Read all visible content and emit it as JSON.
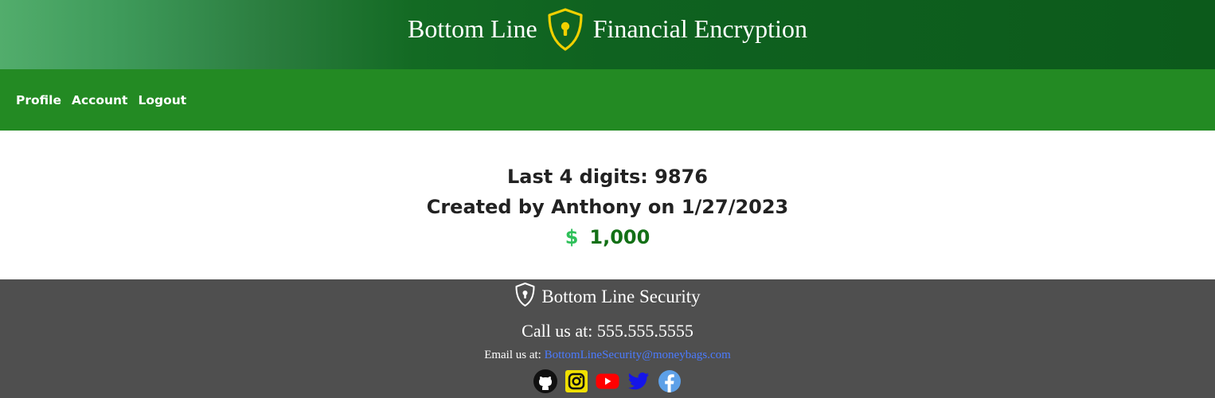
{
  "header": {
    "title_left": "Bottom Line",
    "title_right": "Financial Encryption",
    "logo_icon": "shield-keyhole-icon",
    "accent_color": "#f0d000"
  },
  "nav": {
    "items": [
      {
        "label": "Profile"
      },
      {
        "label": "Account"
      },
      {
        "label": "Logout"
      }
    ]
  },
  "account": {
    "last_digits": "Last 4 digits: 9876",
    "created": "Created by Anthony on 1/27/2023",
    "currency_symbol": "$",
    "balance": "1,000"
  },
  "footer": {
    "brand": "Bottom Line Security",
    "phone": "Call us at: 555.555.5555",
    "email_label": "Email us at:",
    "email": "BottomLineSecurity@moneybags.com",
    "socials": [
      "github-icon",
      "instagram-icon",
      "youtube-icon",
      "twitter-icon",
      "facebook-icon"
    ]
  }
}
